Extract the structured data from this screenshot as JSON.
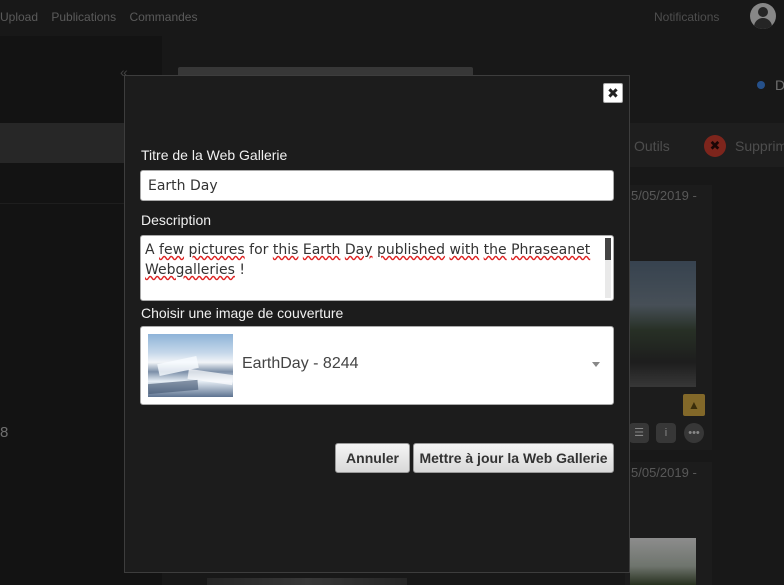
{
  "topnav": {
    "items": [
      "Upload",
      "Publications",
      "Commandes"
    ],
    "notifications": "Notifications"
  },
  "background": {
    "side_number": "8",
    "d_label": "D",
    "tools_label": "Outils",
    "delete_label": "Supprim",
    "card_dates": [
      "5/05/2019 -",
      "5/05/2019 -"
    ]
  },
  "modal": {
    "title_label": "Titre de la Web Gallerie",
    "title_value": "Earth Day",
    "description_label": "Description",
    "description_words": [
      "A",
      "few",
      "pictures",
      "for",
      "this",
      "Earth",
      "Day",
      "published",
      "with",
      "the",
      "Phraseanet",
      "Webgalleries",
      "!"
    ],
    "cover_label": "Choisir une image de couverture",
    "cover_value": "EarthDay - 8244",
    "cancel_label": "Annuler",
    "submit_label": "Mettre à jour la Web Gallerie",
    "close_symbol": "✖"
  }
}
